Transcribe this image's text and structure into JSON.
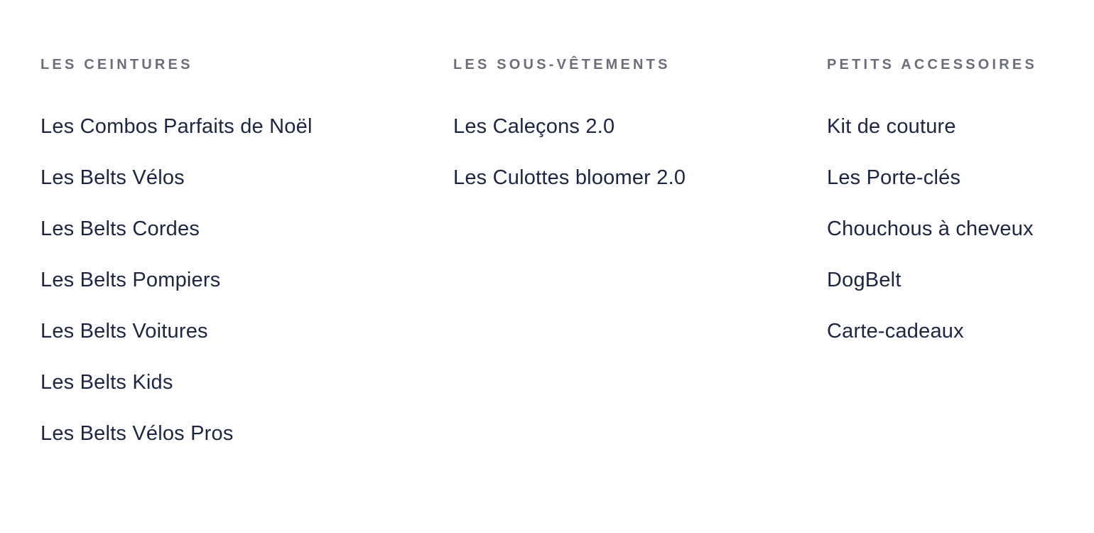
{
  "columns": [
    {
      "heading": "LES CEINTURES",
      "links": [
        "Les Combos Parfaits de Noël",
        "Les Belts Vélos",
        "Les Belts Cordes",
        "Les Belts Pompiers",
        "Les Belts Voitures",
        "Les Belts Kids",
        "Les Belts Vélos Pros"
      ]
    },
    {
      "heading": "LES SOUS-VÊTEMENTS",
      "links": [
        "Les Caleçons 2.0",
        "Les Culottes bloomer 2.0"
      ]
    },
    {
      "heading": "PETITS ACCESSOIRES",
      "links": [
        "Kit de couture",
        "Les Porte-clés",
        "Chouchous à cheveux",
        "DogBelt",
        "Carte-cadeaux"
      ]
    }
  ]
}
